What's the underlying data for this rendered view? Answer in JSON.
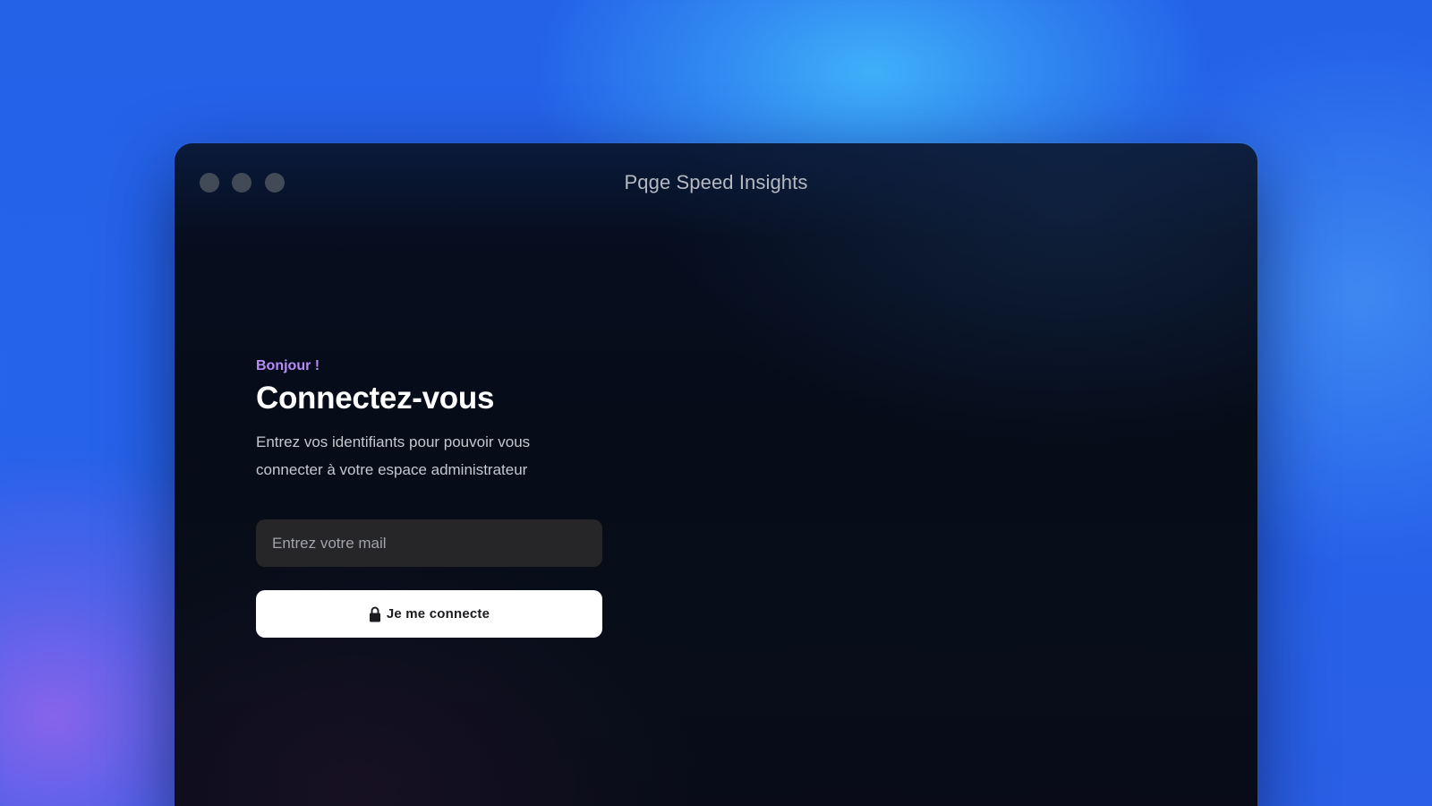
{
  "window": {
    "title": "Pqge Speed Insights"
  },
  "login": {
    "greeting": "Bonjour !",
    "heading": "Connectez-vous",
    "description": "Entrez vos identifiants pour pouvoir vous connecter à votre espace administrateur",
    "email_placeholder": "Entrez votre mail",
    "email_value": "",
    "submit_label": "Je me connecte",
    "submit_icon": "lock-icon"
  },
  "colors": {
    "background_accent": "#2563eb",
    "greeting_accent": "#b58cf5",
    "window_background": "#060c18",
    "input_background": "#262628",
    "button_background": "#ffffff"
  }
}
